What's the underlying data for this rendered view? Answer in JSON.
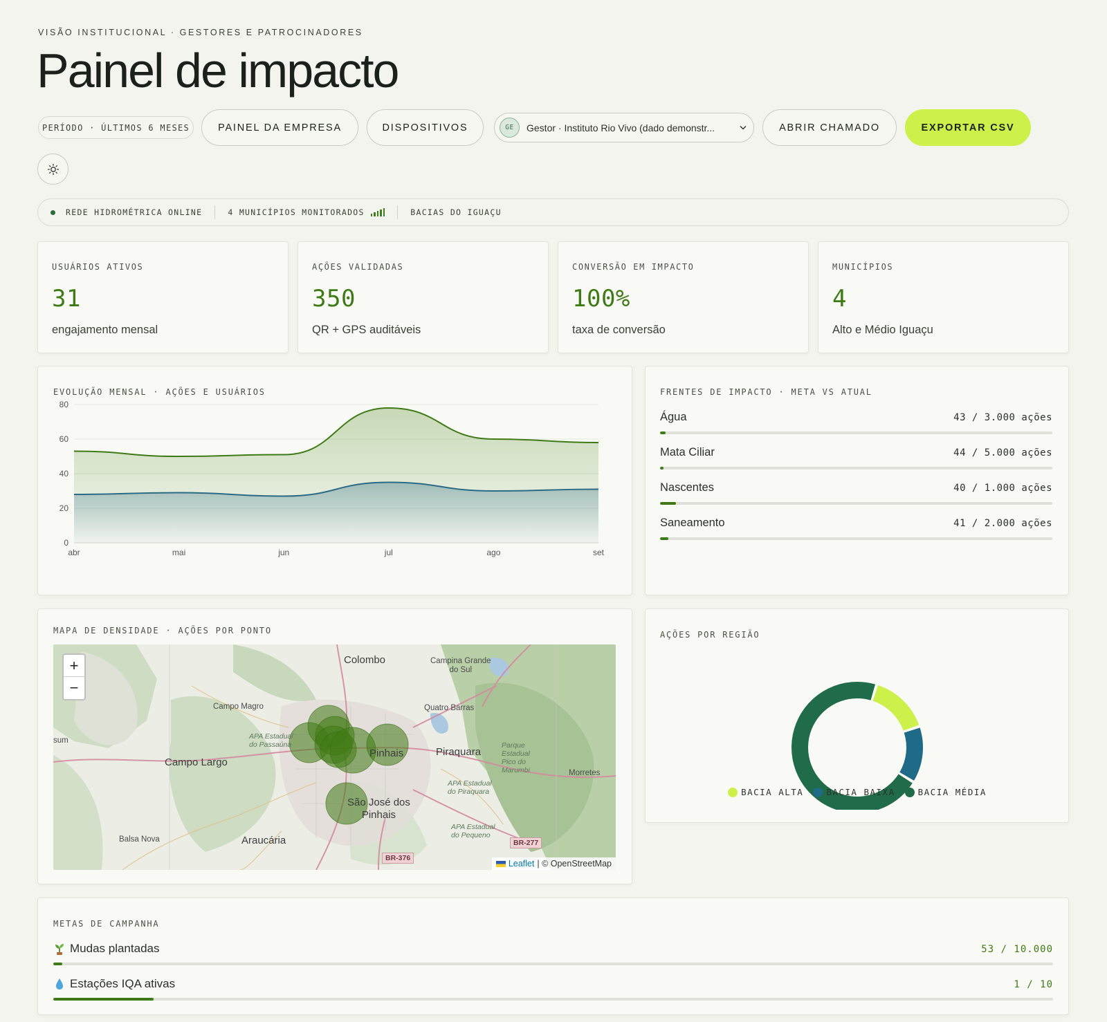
{
  "header": {
    "eyebrow": "VISÃO INSTITUCIONAL · GESTORES E PATROCINADORES",
    "title": "Painel de impacto"
  },
  "toolbar": {
    "period": "PERÍODO · ÚLTIMOS 6 MESES",
    "company_panel": "PAINEL DA EMPRESA",
    "devices": "DISPOSITIVOS",
    "gestor_initials": "GE",
    "gestor_value": "Gestor · Instituto Rio Vivo (dado demonstr...",
    "open_ticket": "ABRIR CHAMADO",
    "export_csv": "EXPORTAR CSV"
  },
  "status": {
    "network": "REDE HIDROMÉTRICA ONLINE",
    "municipalities": "4 MUNICÍPIOS MONITORADOS",
    "basins": "BACIAS DO IGUAÇU"
  },
  "kpis": [
    {
      "label": "USUÁRIOS ATIVOS",
      "value": "31",
      "sub": "engajamento mensal"
    },
    {
      "label": "AÇÕES VALIDADAS",
      "value": "350",
      "sub": "QR + GPS auditáveis"
    },
    {
      "label": "CONVERSÃO EM IMPACTO",
      "value": "100%",
      "sub": "taxa de conversão"
    },
    {
      "label": "MUNICÍPIOS",
      "value": "4",
      "sub": "Alto e Médio Iguaçu"
    }
  ],
  "evolution": {
    "title": "EVOLUÇÃO MENSAL · AÇÕES E USUÁRIOS"
  },
  "chart_data": {
    "type": "area",
    "categories": [
      "abr",
      "mai",
      "jun",
      "jul",
      "ago",
      "set"
    ],
    "yticks": [
      "0",
      "20",
      "40",
      "60",
      "80"
    ],
    "ylim": [
      0,
      80
    ],
    "series": [
      {
        "values": [
          53,
          50,
          51,
          78,
          60,
          58
        ],
        "color": "#3e7a16"
      },
      {
        "values": [
          28,
          29,
          27,
          35,
          30,
          31
        ],
        "color": "#2a6a84"
      }
    ]
  },
  "fronts": {
    "title": "FRENTES DE IMPACTO · META VS ATUAL",
    "items": [
      {
        "name": "Água",
        "value": "43 / 3.000 ações",
        "progress": 0.0143
      },
      {
        "name": "Mata Ciliar",
        "value": "44 / 5.000 ações",
        "progress": 0.0088
      },
      {
        "name": "Nascentes",
        "value": "40 / 1.000 ações",
        "progress": 0.04
      },
      {
        "name": "Saneamento",
        "value": "41 / 2.000 ações",
        "progress": 0.0205
      }
    ]
  },
  "density_map": {
    "title": "MAPA DE DENSIDADE · AÇÕES POR PONTO",
    "zoom_in": "+",
    "zoom_out": "−",
    "attribution_link": "Leaflet",
    "attribution_text": "| © OpenStreetMap",
    "places": {
      "colombo": "Colombo",
      "campina": "Campina Grande\ndo Sul",
      "campo_magro": "Campo Magro",
      "quatro_barras": "Quatro Barras",
      "apa_passauna": "APA Estadual\ndo Passaúna",
      "sum": "sum",
      "campo_largo": "Campo Largo",
      "pinhais": "Pinhais",
      "piraquara": "Piraquara",
      "parque": "Parque\nEstadual\nPico do\nMarumbi",
      "morretes": "Morretes",
      "apa_piraquara": "APA Estadual\ndo Piraquara",
      "sao_jose": "São José dos\nPinhais",
      "apa_pequeno": "APA Estadual\ndo Pequeno",
      "balsa_nova": "Balsa Nova",
      "araucaria": "Araucária",
      "br277": "BR-277",
      "br376": "BR-376"
    }
  },
  "regions": {
    "title": "AÇÕES POR REGIÃO",
    "slices": [
      {
        "name": "BACIA ALTA",
        "value": 15,
        "color": "#cdf04a"
      },
      {
        "name": "BACIA BAIXA",
        "value": 14,
        "color": "#1f6a86"
      },
      {
        "name": "BACIA MÉDIA",
        "value": 71,
        "color": "#1f6b4a"
      }
    ]
  },
  "goals": {
    "title": "METAS DE CAMPANHA",
    "items": [
      {
        "icon": "seedling-icon",
        "name": "Mudas plantadas",
        "value": "53 / 10.000",
        "progress": 0.0053
      },
      {
        "icon": "droplet-icon",
        "name": "Estações IQA ativas",
        "value": "1 / 10",
        "progress": 0.1
      }
    ]
  },
  "colors": {
    "accent": "#3e7a16",
    "lime": "#cdf04a",
    "background": "#f3f4ed"
  }
}
